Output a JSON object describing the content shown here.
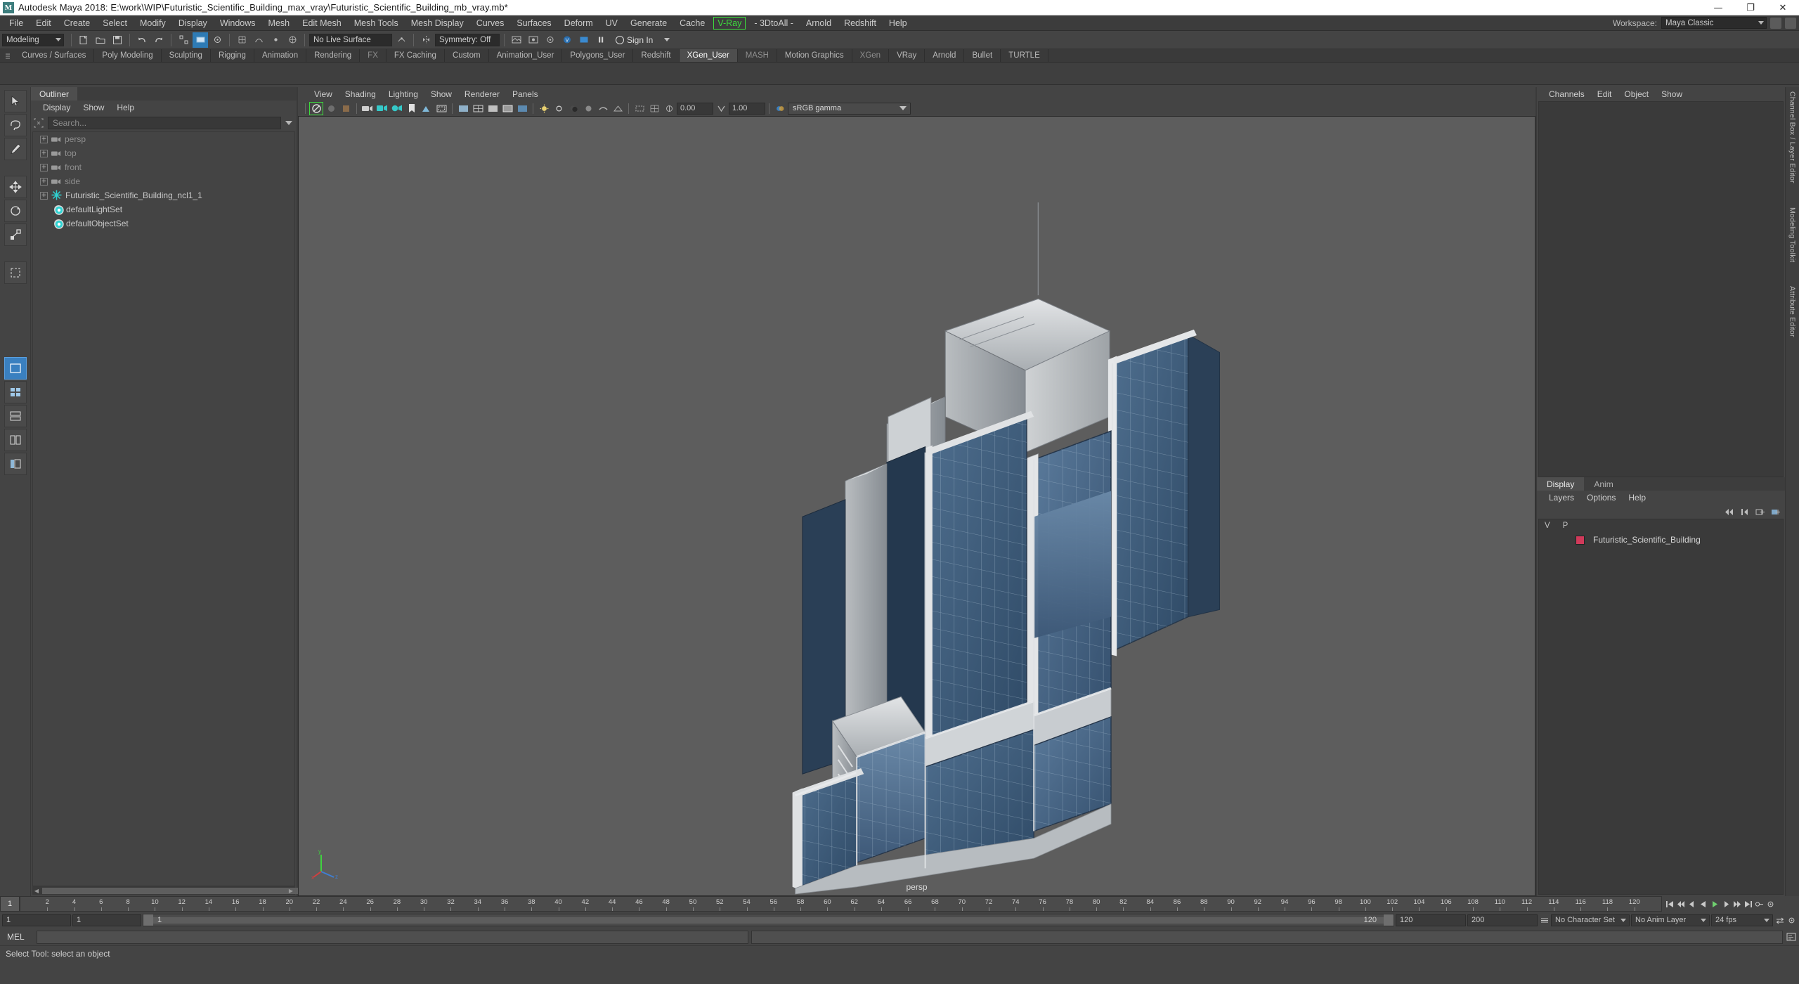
{
  "window": {
    "title": "Autodesk Maya 2018: E:\\work\\WIP\\Futuristic_Scientific_Building_max_vray\\Futuristic_Scientific_Building_mb_vray.mb*",
    "logo_letter": "M",
    "minimize": "—",
    "maximize": "❐",
    "close": "✕"
  },
  "menubar": {
    "items": [
      {
        "label": "File"
      },
      {
        "label": "Edit"
      },
      {
        "label": "Create"
      },
      {
        "label": "Select"
      },
      {
        "label": "Modify"
      },
      {
        "label": "Display"
      },
      {
        "label": "Windows"
      },
      {
        "label": "Mesh"
      },
      {
        "label": "Edit Mesh"
      },
      {
        "label": "Mesh Tools"
      },
      {
        "label": "Mesh Display"
      },
      {
        "label": "Curves"
      },
      {
        "label": "Surfaces"
      },
      {
        "label": "Deform"
      },
      {
        "label": "UV"
      },
      {
        "label": "Generate"
      },
      {
        "label": "Cache"
      },
      {
        "label": "V-Ray"
      },
      {
        "label": "- 3DtoAll -"
      },
      {
        "label": "Arnold"
      },
      {
        "label": "Redshift"
      },
      {
        "label": "Help"
      }
    ],
    "workspace_label": "Workspace:",
    "workspace_value": "Maya Classic"
  },
  "statusline": {
    "mode": "Modeling",
    "live_surface": "No Live Surface",
    "symmetry": "Symmetry: Off",
    "signin": "Sign In"
  },
  "shelf": {
    "tabs": [
      {
        "label": "Curves / Surfaces",
        "active": false
      },
      {
        "label": "Poly Modeling",
        "active": false
      },
      {
        "label": "Sculpting",
        "active": false
      },
      {
        "label": "Rigging",
        "active": false
      },
      {
        "label": "Animation",
        "active": false
      },
      {
        "label": "Rendering",
        "active": false
      },
      {
        "label": "FX",
        "active": false
      },
      {
        "label": "FX Caching",
        "active": false
      },
      {
        "label": "Custom",
        "active": false
      },
      {
        "label": "Animation_User",
        "active": false
      },
      {
        "label": "Polygons_User",
        "active": false
      },
      {
        "label": "Redshift",
        "active": false
      },
      {
        "label": "XGen_User",
        "active": true
      },
      {
        "label": "MASH",
        "active": false
      },
      {
        "label": "Motion Graphics",
        "active": false
      },
      {
        "label": "XGen",
        "active": false
      },
      {
        "label": "VRay",
        "active": false
      },
      {
        "label": "Arnold",
        "active": false
      },
      {
        "label": "Bullet",
        "active": false
      },
      {
        "label": "TURTLE",
        "active": false
      }
    ]
  },
  "outliner": {
    "tab_label": "Outliner",
    "menu": [
      "Display",
      "Show",
      "Help"
    ],
    "search_placeholder": "Search...",
    "items": [
      {
        "label": "persp",
        "icon": "camera-icon",
        "dim": true,
        "expandable": true
      },
      {
        "label": "top",
        "icon": "camera-icon",
        "dim": true,
        "expandable": true
      },
      {
        "label": "front",
        "icon": "camera-icon",
        "dim": true,
        "expandable": true
      },
      {
        "label": "side",
        "icon": "camera-icon",
        "dim": true,
        "expandable": true
      },
      {
        "label": "Futuristic_Scientific_Building_ncl1_1",
        "icon": "transform-star-icon",
        "dim": false,
        "expandable": true
      },
      {
        "label": "defaultLightSet",
        "icon": "set-icon",
        "dim": false,
        "expandable": false
      },
      {
        "label": "defaultObjectSet",
        "icon": "set-icon",
        "dim": false,
        "expandable": false
      }
    ]
  },
  "viewport": {
    "menu": [
      "View",
      "Shading",
      "Lighting",
      "Show",
      "Renderer",
      "Panels"
    ],
    "exposure": "0.00",
    "gamma_value": "1.00",
    "colorspace": "sRGB gamma",
    "camera_label": "persp",
    "axis": {
      "x": "x",
      "y": "y",
      "z": "z"
    }
  },
  "channelbox": {
    "menu": [
      "Channels",
      "Edit",
      "Object",
      "Show"
    ],
    "side_tabs": [
      "Channel Box / Layer Editor",
      "Modeling Toolkit",
      "Attribute Editor"
    ]
  },
  "layers": {
    "tabs": [
      {
        "label": "Display",
        "active": true
      },
      {
        "label": "Anim",
        "active": false
      }
    ],
    "menu": [
      "Layers",
      "Options",
      "Help"
    ],
    "headers": {
      "v": "V",
      "p": "P"
    },
    "rows": [
      {
        "v": "",
        "p": "",
        "color": "#d03a5a",
        "name": "Futuristic_Scientific_Building"
      }
    ]
  },
  "timeline": {
    "current_frame_left": "1",
    "ticks": [
      2,
      4,
      6,
      8,
      10,
      12,
      14,
      16,
      18,
      20,
      22,
      24,
      26,
      28,
      30,
      32,
      34,
      36,
      38,
      40,
      42,
      44,
      46,
      48,
      50,
      52,
      54,
      56,
      58,
      60,
      62,
      64,
      66,
      68,
      70,
      72,
      74,
      76,
      78,
      80,
      82,
      84,
      86,
      88,
      90,
      92,
      94,
      96,
      98,
      100,
      102,
      104,
      106,
      108,
      110,
      112,
      114,
      116,
      118,
      120
    ],
    "current_frame_field": "1",
    "start_field": "1",
    "range_start": "1",
    "range_end": "120",
    "playback_start": "120",
    "playback_end": "200",
    "character_set": "No Character Set",
    "anim_layer": "No Anim Layer",
    "fps": "24 fps",
    "range_start_box": "1",
    "range_end_box": "120"
  },
  "command": {
    "mel_label": "MEL",
    "input_value": "",
    "status_text": "Select Tool: select an object"
  }
}
